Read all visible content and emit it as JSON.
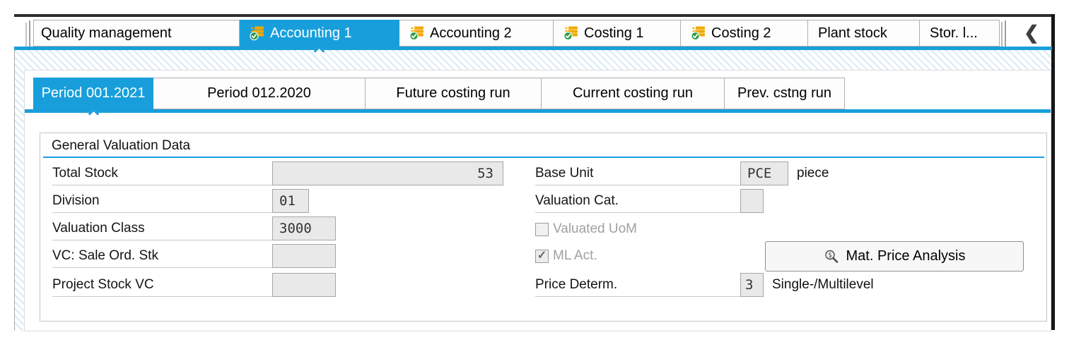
{
  "tabs": {
    "scroll_left_glyph": "❮",
    "items": [
      {
        "label": "Quality management",
        "icon": null,
        "selected": false
      },
      {
        "label": "Accounting 1",
        "icon": "coins-checked",
        "selected": true
      },
      {
        "label": "Accounting 2",
        "icon": "coins-checked",
        "selected": false
      },
      {
        "label": "Costing 1",
        "icon": "coins-checked",
        "selected": false
      },
      {
        "label": "Costing 2",
        "icon": "coins-checked",
        "selected": false
      },
      {
        "label": "Plant stock",
        "icon": null,
        "selected": false
      },
      {
        "label": "Stor. l...",
        "icon": null,
        "selected": false
      }
    ]
  },
  "subtabs": {
    "items": [
      {
        "label": "Period 001.2021",
        "selected": true
      },
      {
        "label": "Period 012.2020",
        "selected": false
      },
      {
        "label": "Future costing run",
        "selected": false
      },
      {
        "label": "Current costing run",
        "selected": false
      },
      {
        "label": "Prev. cstng run",
        "selected": false
      }
    ]
  },
  "valuation": {
    "title": "General Valuation Data",
    "fields": {
      "total_stock": {
        "label": "Total Stock",
        "value": "53"
      },
      "division": {
        "label": "Division",
        "value": "01"
      },
      "valuation_class": {
        "label": "Valuation Class",
        "value": "3000"
      },
      "vc_sale": {
        "label": "VC: Sale Ord. Stk",
        "value": ""
      },
      "project_vc": {
        "label": "Project Stock VC",
        "value": ""
      },
      "base_unit": {
        "label": "Base Unit",
        "value": "PCE",
        "suffix": "piece"
      },
      "valuation_cat": {
        "label": "Valuation Cat.",
        "value": ""
      },
      "valuated_uom": {
        "label": "Valuated UoM",
        "checked": false,
        "check_glyph": ""
      },
      "ml_act": {
        "label": "ML Act.",
        "checked": true,
        "check_glyph": "✓"
      },
      "price_determ": {
        "label": "Price Determ.",
        "value": "3",
        "suffix": "Single-/Multilevel"
      }
    },
    "button": {
      "label": "Mat. Price Analysis"
    }
  },
  "colors": {
    "accent_blue": "#189fdb",
    "field_bg": "#e9e9e9",
    "field_border": "#a6a6a6",
    "disabled_text": "#a0a0a0",
    "icon_gold": "#f2a800",
    "icon_green": "#2f9e44"
  }
}
